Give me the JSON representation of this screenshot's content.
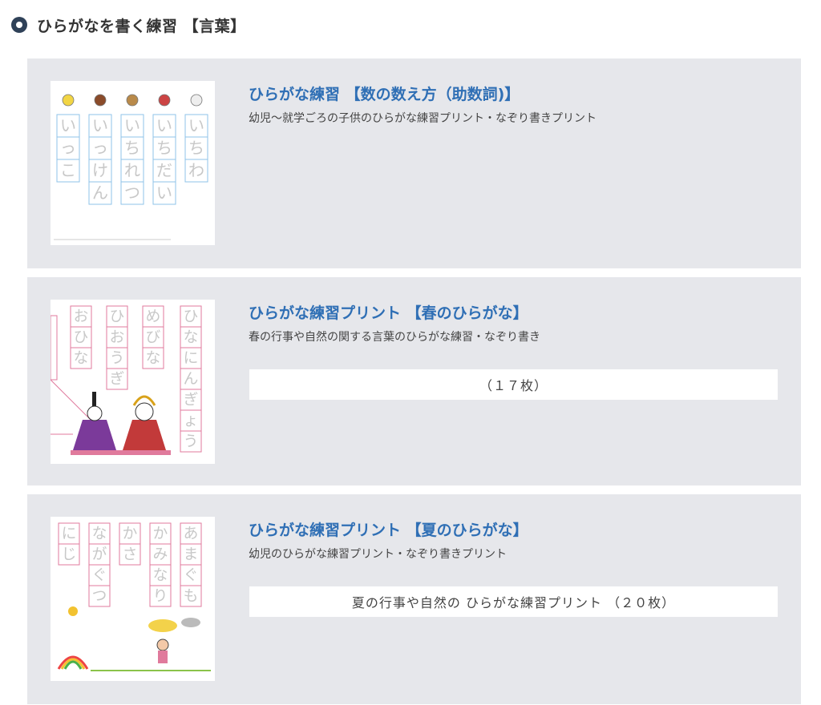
{
  "section": {
    "title": "ひらがなを書く練習 【言葉】"
  },
  "cards": [
    {
      "title": "ひらがな練習 【数の数え方（助数詞)】",
      "description": "幼児〜就学ごろの子供のひらがな練習プリント・なぞり書きプリント",
      "thumbnail_words": [
        "いっこ",
        "いっけん",
        "いちれつ",
        "いちだい",
        "いちわ"
      ],
      "thumbnail_icons": [
        "lemon-icon",
        "house-icon",
        "fence-icon",
        "car-icon",
        "bird-icon"
      ]
    },
    {
      "title": "ひらがな練習プリント 【春のひらがな】",
      "description": "春の行事や自然の関する言葉のひらがな練習・なぞり書き",
      "sub_label": "（１７枚）",
      "thumbnail_words": [
        "おひな",
        "ひおうぎ",
        "めびな",
        "ひなにんぎょう"
      ],
      "thumbnail_illustration": "hina-dolls-illustration"
    },
    {
      "title": "ひらがな練習プリント 【夏のひらがな】",
      "description": "幼児のひらがな練習プリント・なぞり書きプリント",
      "sub_label": "夏の行事や自然の ひらがな練習プリント （２０枚）",
      "thumbnail_words": [
        "にじ",
        "ながぐつ",
        "かさ",
        "かみなり",
        "あまぐも"
      ],
      "thumbnail_illustration": "rainy-summer-illustration"
    }
  ],
  "colors": {
    "card_bg": "#e6e7eb",
    "title_blue": "#2f6fb5",
    "bullet": "#2f4158",
    "trace_blue": "#8fc3e8",
    "trace_pink": "#e07a9c"
  }
}
